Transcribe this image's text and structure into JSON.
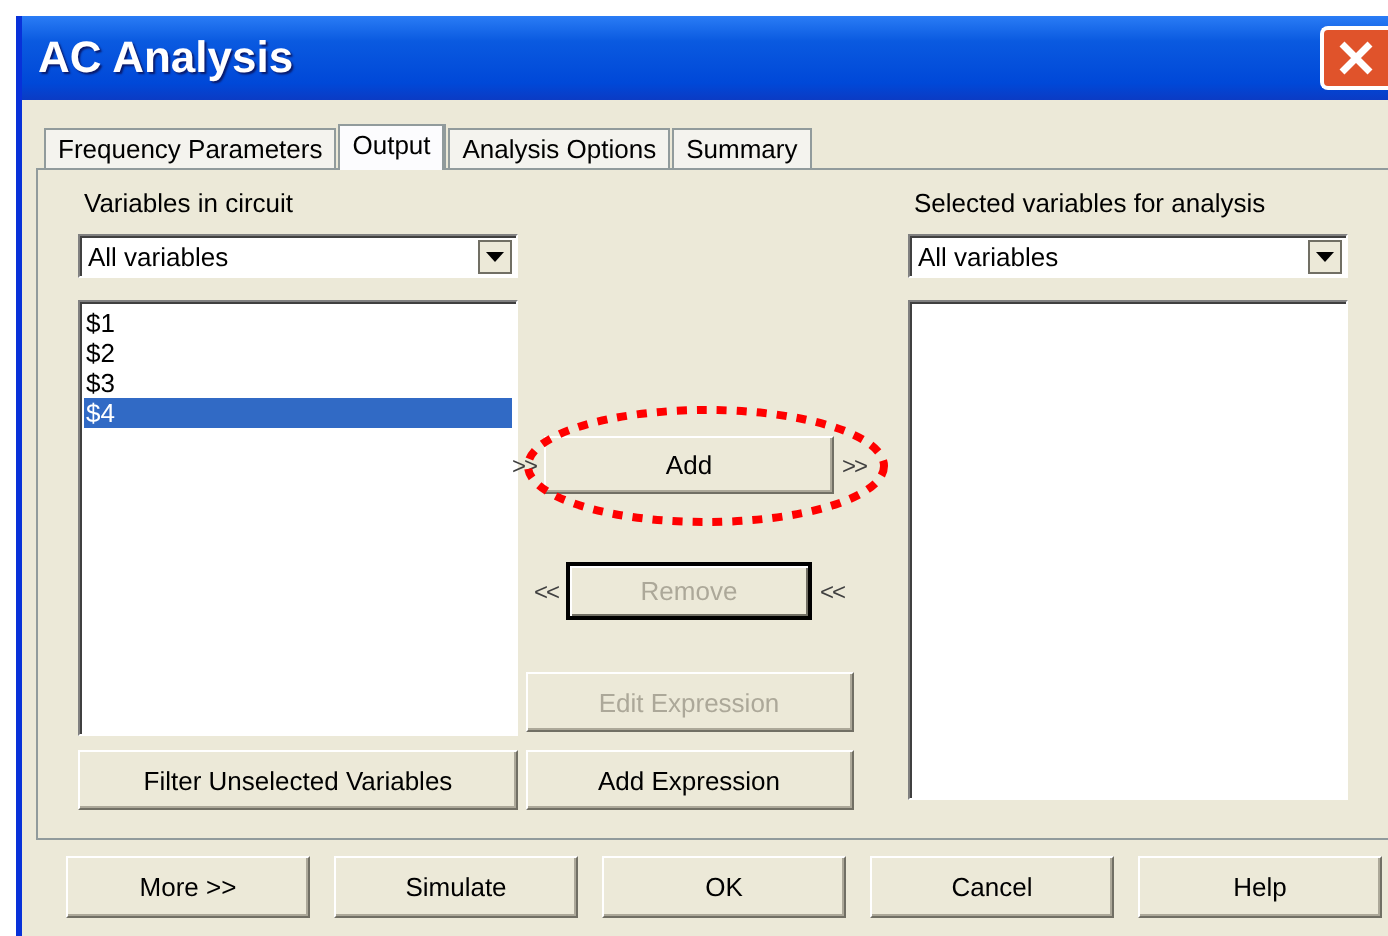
{
  "window": {
    "title": "AC Analysis"
  },
  "tabs": [
    {
      "label": "Frequency Parameters",
      "selected": false
    },
    {
      "label": "Output",
      "selected": true
    },
    {
      "label": "Analysis Options",
      "selected": false
    },
    {
      "label": "Summary",
      "selected": false
    }
  ],
  "variables_in_circuit": {
    "label": "Variables in circuit",
    "filter": "All variables",
    "items": [
      {
        "label": "$1",
        "selected": false
      },
      {
        "label": "$2",
        "selected": false
      },
      {
        "label": "$3",
        "selected": false
      },
      {
        "label": "$4",
        "selected": true
      }
    ],
    "button": "Filter Unselected Variables"
  },
  "selected_variables": {
    "label": "Selected variables for analysis",
    "filter": "All variables"
  },
  "actions": [
    {
      "label": "Add",
      "arrow_left": ">>",
      "arrow_right": ">>",
      "disabled": false,
      "focused": false
    },
    {
      "label": "Remove",
      "arrow_left": "<<",
      "arrow_right": "<<",
      "disabled": true,
      "focused": true
    },
    {
      "label": "Edit Expression",
      "disabled": true,
      "focused": false
    },
    {
      "label": "Add Expression",
      "disabled": false,
      "focused": false
    }
  ],
  "buttons": [
    "More >>",
    "Simulate",
    "OK",
    "Cancel",
    "Help"
  ]
}
